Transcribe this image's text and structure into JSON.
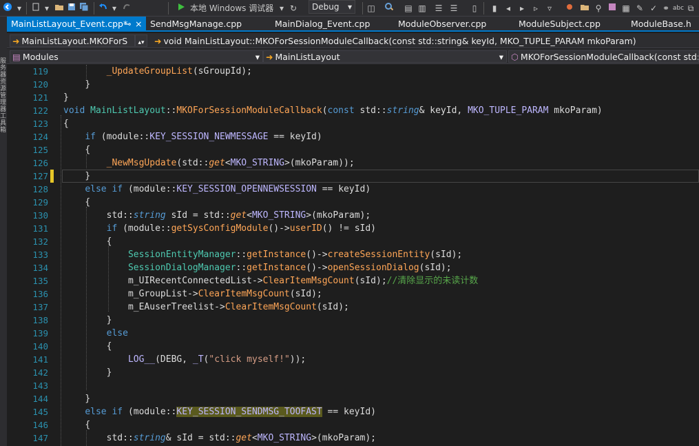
{
  "toolbar": {
    "debugger_label": "本地 Windows 调试器",
    "config_value": "Debug"
  },
  "sidebar": {
    "text": "服务器资源管理器 工具箱"
  },
  "tabs": [
    {
      "label": "MainListLayout_Event.cpp*",
      "pin": "⊸",
      "close": "×"
    },
    {
      "label": "SendMsgManage.cpp"
    },
    {
      "label": "MainDialog_Event.cpp"
    },
    {
      "label": "ModuleObserver.cpp"
    },
    {
      "label": "ModuleSubject.cpp"
    },
    {
      "label": "ModuleBase.h"
    }
  ],
  "nav1": {
    "class_combo": "MainListLayout.MKOForS",
    "member_combo": "void MainListLayout::MKOForSessionModuleCallback(const std::string& keyId, MKO_TUPLE_PARAM mkoParam)"
  },
  "nav2": {
    "project_combo": "Modules",
    "scope_combo": "MainListLayout",
    "function_combo": "MKOForSessionModuleCallback(const std::s"
  },
  "colors": {
    "accent": "#007acc",
    "change_marker": "#e6c628",
    "line_number": "#2b91af"
  },
  "lines": [
    {
      "n": "119",
      "indent": 2,
      "tokens": [
        [
          "fn",
          "_UpdateGroupList"
        ],
        [
          "pl",
          "(sGroupId);"
        ]
      ]
    },
    {
      "n": "120",
      "indent": 1,
      "tokens": [
        [
          "pl",
          "}"
        ]
      ]
    },
    {
      "n": "121",
      "indent": 0,
      "tokens": [
        [
          "pl",
          "}"
        ]
      ]
    },
    {
      "n": "122",
      "indent": 0,
      "tokens": [
        [
          "kw",
          "void "
        ],
        [
          "ty",
          "MainListLayout"
        ],
        [
          "pl",
          "::"
        ],
        [
          "fn",
          "MKOForSessionModuleCallback"
        ],
        [
          "pl",
          "("
        ],
        [
          "kw",
          "const "
        ],
        [
          "pl",
          "std::"
        ],
        [
          "kw it",
          "string"
        ],
        [
          "pl",
          "& keyId, "
        ],
        [
          "mc",
          "MKO_TUPLE_PARAM"
        ],
        [
          "pl",
          " mkoParam)"
        ]
      ]
    },
    {
      "n": "123",
      "indent": 0,
      "tokens": [
        [
          "pl",
          "{"
        ]
      ]
    },
    {
      "n": "124",
      "indent": 1,
      "tokens": [
        [
          "kw",
          "if "
        ],
        [
          "pl",
          "(module::"
        ],
        [
          "mc",
          "KEY_SESSION_NEWMESSAGE"
        ],
        [
          "pl",
          " == keyId)"
        ]
      ]
    },
    {
      "n": "125",
      "indent": 1,
      "tokens": [
        [
          "pl",
          "{"
        ]
      ]
    },
    {
      "n": "126",
      "indent": 2,
      "tokens": [
        [
          "fn",
          "_NewMsgUpdate"
        ],
        [
          "pl",
          "(std::"
        ],
        [
          "fn it",
          "get"
        ],
        [
          "pl",
          "<"
        ],
        [
          "mc",
          "MKO_STRING"
        ],
        [
          "pl",
          ">(mkoParam));"
        ]
      ]
    },
    {
      "n": "127",
      "indent": 1,
      "tokens": [
        [
          "pl",
          "}"
        ]
      ],
      "current": true
    },
    {
      "n": "128",
      "indent": 1,
      "tokens": [
        [
          "kw",
          "else if "
        ],
        [
          "pl",
          "(module::"
        ],
        [
          "mc",
          "KEY_SESSION_OPENNEWSESSION"
        ],
        [
          "pl",
          " == keyId)"
        ]
      ]
    },
    {
      "n": "129",
      "indent": 1,
      "tokens": [
        [
          "pl",
          "{"
        ]
      ]
    },
    {
      "n": "130",
      "indent": 2,
      "tokens": [
        [
          "pl",
          "std::"
        ],
        [
          "kw it",
          "string"
        ],
        [
          "pl",
          " sId = std::"
        ],
        [
          "fn it",
          "get"
        ],
        [
          "pl",
          "<"
        ],
        [
          "mc",
          "MKO_STRING"
        ],
        [
          "pl",
          ">(mkoParam);"
        ]
      ]
    },
    {
      "n": "131",
      "indent": 2,
      "tokens": [
        [
          "kw",
          "if "
        ],
        [
          "pl",
          "(module::"
        ],
        [
          "fn",
          "getSysConfigModule"
        ],
        [
          "pl",
          "()->"
        ],
        [
          "fn",
          "userID"
        ],
        [
          "pl",
          "() != sId)"
        ]
      ]
    },
    {
      "n": "132",
      "indent": 2,
      "tokens": [
        [
          "pl",
          "{"
        ]
      ]
    },
    {
      "n": "133",
      "indent": 3,
      "tokens": [
        [
          "ty fn",
          "SessionEntityManager"
        ],
        [
          "pl",
          "::"
        ],
        [
          "fn",
          "getInstance"
        ],
        [
          "pl",
          "()->"
        ],
        [
          "fn",
          "createSessionEntity"
        ],
        [
          "pl",
          "(sId);"
        ]
      ]
    },
    {
      "n": "134",
      "indent": 3,
      "tokens": [
        [
          "ty fn",
          "SessionDialogManager"
        ],
        [
          "pl",
          "::"
        ],
        [
          "fn",
          "getInstance"
        ],
        [
          "pl",
          "()->"
        ],
        [
          "fn",
          "openSessionDialog"
        ],
        [
          "pl",
          "(sId);"
        ]
      ]
    },
    {
      "n": "135",
      "indent": 3,
      "tokens": [
        [
          "pl",
          "m_UIRecentConnectedList->"
        ],
        [
          "fn",
          "ClearItemMsgCount"
        ],
        [
          "pl",
          "(sId);"
        ],
        [
          "cm",
          "//清除显示的未读计数"
        ]
      ]
    },
    {
      "n": "136",
      "indent": 3,
      "tokens": [
        [
          "pl",
          "m_GroupList->"
        ],
        [
          "fn",
          "ClearItemMsgCount"
        ],
        [
          "pl",
          "(sId);"
        ]
      ]
    },
    {
      "n": "137",
      "indent": 3,
      "tokens": [
        [
          "pl",
          "m_EAuserTreelist->"
        ],
        [
          "fn",
          "ClearItemMsgCount"
        ],
        [
          "pl",
          "(sId);"
        ]
      ]
    },
    {
      "n": "138",
      "indent": 2,
      "tokens": [
        [
          "pl",
          "}"
        ]
      ]
    },
    {
      "n": "139",
      "indent": 2,
      "tokens": [
        [
          "kw",
          "else"
        ]
      ]
    },
    {
      "n": "140",
      "indent": 2,
      "tokens": [
        [
          "pl",
          "{"
        ]
      ]
    },
    {
      "n": "141",
      "indent": 3,
      "tokens": [
        [
          "mc fn",
          "LOG__"
        ],
        [
          "pl",
          "(DEBG, "
        ],
        [
          "mc fn",
          "_T"
        ],
        [
          "pl",
          "("
        ],
        [
          "st",
          "\"click myself!\""
        ],
        [
          "pl",
          "));"
        ]
      ]
    },
    {
      "n": "142",
      "indent": 2,
      "tokens": [
        [
          "pl",
          "}"
        ]
      ]
    },
    {
      "n": "143",
      "indent": 0,
      "tokens": []
    },
    {
      "n": "144",
      "indent": 1,
      "tokens": [
        [
          "pl",
          "}"
        ]
      ]
    },
    {
      "n": "145",
      "indent": 1,
      "tokens": [
        [
          "kw",
          "else if "
        ],
        [
          "pl",
          "(module::"
        ],
        [
          "mc hl",
          "KEY_SESSION_SENDMSG_TOOFAST"
        ],
        [
          "pl",
          " == keyId)"
        ]
      ]
    },
    {
      "n": "146",
      "indent": 1,
      "tokens": [
        [
          "pl",
          "{"
        ]
      ]
    },
    {
      "n": "147",
      "indent": 2,
      "tokens": [
        [
          "pl",
          "std::"
        ],
        [
          "kw it",
          "string"
        ],
        [
          "pl",
          "& sId = std::"
        ],
        [
          "fn it",
          "get"
        ],
        [
          "pl",
          "<"
        ],
        [
          "mc",
          "MKO_STRING"
        ],
        [
          "pl",
          ">(mkoParam);"
        ]
      ]
    }
  ]
}
